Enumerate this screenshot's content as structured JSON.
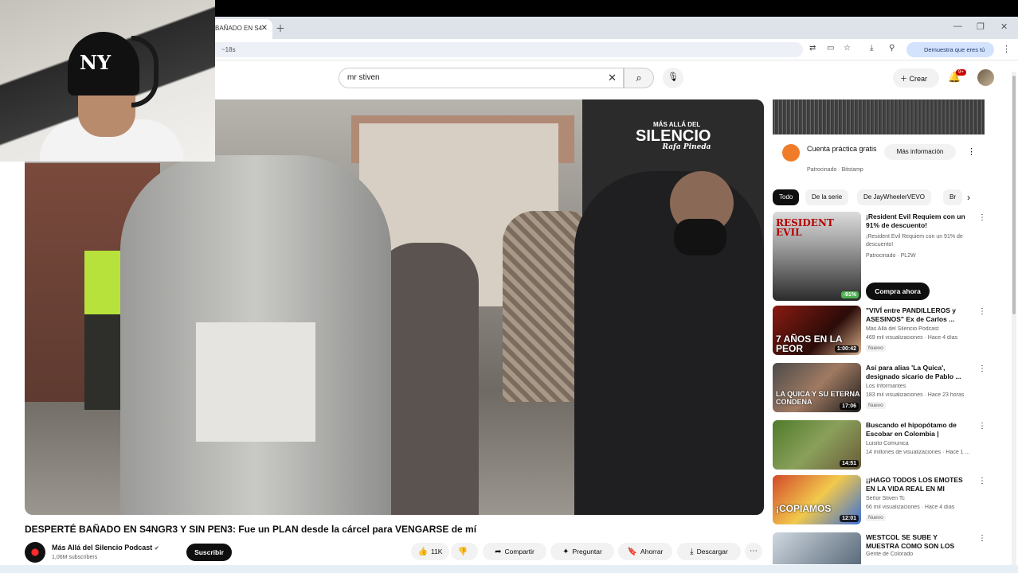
{
  "browser": {
    "tab_title": "BAÑADO EN S4",
    "url_fragment": "~18s",
    "promo": "Demuestra que eres tú"
  },
  "search": {
    "query": "mr stiven"
  },
  "header": {
    "create_label": "Crear",
    "notifications_badge": "9+"
  },
  "video": {
    "title": "DESPERTÉ BAÑADO EN S4NGR3 Y SIN PEN3: Fue un PLAN desde la cárcel para VENGARSE de mí",
    "watermark_line1": "MÁS ALLÁ DEL",
    "watermark_line2": "SILENCIO",
    "watermark_line3": "Rafa Pineda"
  },
  "channel": {
    "name": "Más Allá del Silencio Podcast",
    "subscribers": "1,06M subscribers",
    "subscribe_label": "Suscribir"
  },
  "actions": {
    "likes": "11K",
    "share": "Compartir",
    "ask": "Preguntar",
    "save": "Ahorrar",
    "download": "Descargar"
  },
  "ad": {
    "title": "Cuenta práctica gratis",
    "sponsor": "Patrocinado · Bitstamp",
    "button": "Más información"
  },
  "chips": [
    "Todo",
    "De la serie",
    "De JayWheelerVEVO",
    "Br"
  ],
  "recommendations": [
    {
      "title": "¡Resident Evil Requiem con un 91% de descuento!",
      "channel": "¡Resident Evil Requiem con un 91% de descuento!",
      "meta": "Patrocinado · PL2W",
      "thumb_text": "RESIDENT EVIL",
      "badge": "-91%",
      "cta": "Compra ahora"
    },
    {
      "title": "\"VIVÍ entre PANDILLEROS y ASESINOS\" Ex de Carlos ...",
      "channel": "Más Allá del Silencio Podcast",
      "meta": "469 mil visualizaciones · Hace 4 días",
      "duration": "1:00:42",
      "thumb_text": "7 AÑOS EN LA PEOR",
      "nuevo": "Nuevo"
    },
    {
      "title": "Así para alias 'La Quica', designado sicario de Pablo ...",
      "channel": "Los Informantes",
      "meta": "183 mil visualizaciones · Hace 23 horas",
      "duration": "17:06",
      "thumb_text": "LA QUICA Y SU ETERNA CONDENA",
      "nuevo": "Nuevo"
    },
    {
      "title": "Buscando el hipopótamo de Escobar en Colombia | ¿Existe...",
      "channel": "Luisito Comunica",
      "meta": "14 millones de visualizaciones · Hace 1 ...",
      "duration": "14:51",
      "thumb_text": ""
    },
    {
      "title": "¡¡HAGO TODOS LOS EMOTES EN LA VIDA REAL EN MI NUEV...",
      "channel": "Señor Stiven Tc",
      "meta": "66 mil visualizaciones · Hace 4 días",
      "duration": "12:01",
      "thumb_text": "¡COPIAMOS",
      "nuevo": "Nuevo"
    },
    {
      "title": "WESTCOL SE SUBE Y MUESTRA COMO SON LOS CARROS ...",
      "channel": "Gente de Colorado",
      "meta": "",
      "duration": "",
      "thumb_text": ""
    }
  ],
  "colors": {
    "accent": "#0f0f0f",
    "red": "#cc0000",
    "promo_bg": "#d3e3fd"
  }
}
